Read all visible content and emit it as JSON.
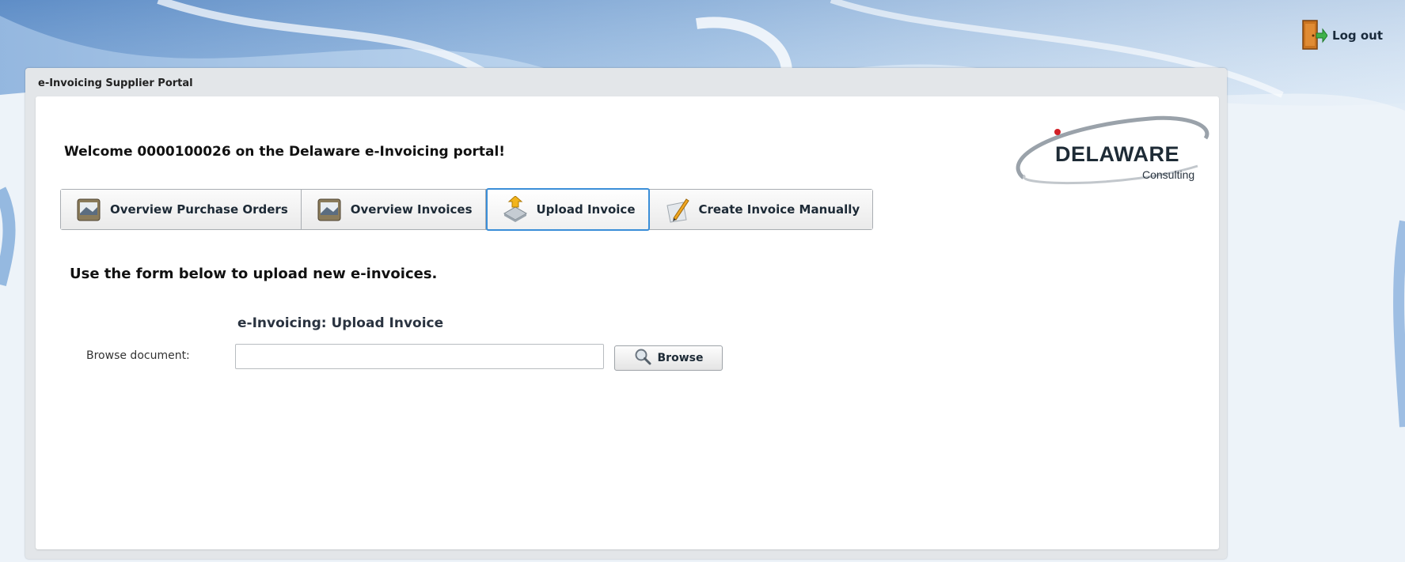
{
  "header": {
    "logout_label": "Log out",
    "logout_icon": "exit-door-icon"
  },
  "portal": {
    "title": "e-Invoicing Supplier Portal",
    "welcome": "Welcome 0000100026 on the Delaware e-Invoicing portal!"
  },
  "logo": {
    "name": "DELAWARE",
    "subtitle": "Consulting"
  },
  "tabs": [
    {
      "label": "Overview Purchase Orders",
      "icon": "folder-icon",
      "active": false
    },
    {
      "label": "Overview Invoices",
      "icon": "folder-icon",
      "active": false
    },
    {
      "label": "Upload Invoice",
      "icon": "upload-icon",
      "active": true
    },
    {
      "label": "Create Invoice Manually",
      "icon": "pencil-icon",
      "active": false
    }
  ],
  "upload": {
    "instruction": "Use the form below to upload new e-invoices.",
    "form_title": "e-Invoicing: Upload Invoice",
    "field_label": "Browse document:",
    "field_value": "",
    "browse_label": "Browse"
  },
  "colors": {
    "accent": "#3a8ed8",
    "frame": "#e3e6e9",
    "text": "#1d2a36"
  }
}
